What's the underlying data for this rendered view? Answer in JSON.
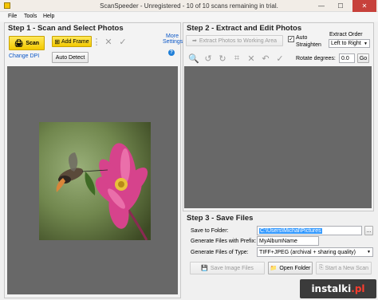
{
  "window": {
    "title": "ScanSpeeder - Unregistered - 10 of 10 scans remaining in trial.",
    "minimize": "—",
    "maximize": "☐",
    "close": "✕"
  },
  "menu": [
    "File",
    "Tools",
    "Help"
  ],
  "step1": {
    "heading": "Step 1 - Scan and Select Photos",
    "scan_label": "Scan",
    "add_frame_label": "Add Frame",
    "more_settings": "More Settings",
    "change_dpi": "Change DPI",
    "auto_detect": "Auto Detect"
  },
  "step2": {
    "heading": "Step 2 - Extract and Edit Photos",
    "extract_label": "Extract Photos to Working Area",
    "auto_straighten": "Auto Straighten",
    "extract_order_label": "Extract Order",
    "extract_order_value": "Left to Right",
    "rotate_label": "Rotate degrees:",
    "rotate_value": "0.0",
    "go_label": "Go"
  },
  "step3": {
    "heading": "Step 3 - Save Files",
    "save_to_label": "Save to Folder:",
    "save_to_value": "C:\\Users\\Michal\\Pictures",
    "browse_label": "...",
    "prefix_label": "Generate Files with Prefix:",
    "prefix_value": "MyAlbumName",
    "type_label": "Generate Files of Type:",
    "type_value": "TIFF+JPEG (archival + sharing quality)",
    "save_images": "Save Image Files",
    "open_folder": "Open Folder",
    "start_new_scan": "Start a New Scan"
  },
  "watermark": {
    "text_a": "instalki",
    "text_b": ".pl"
  }
}
